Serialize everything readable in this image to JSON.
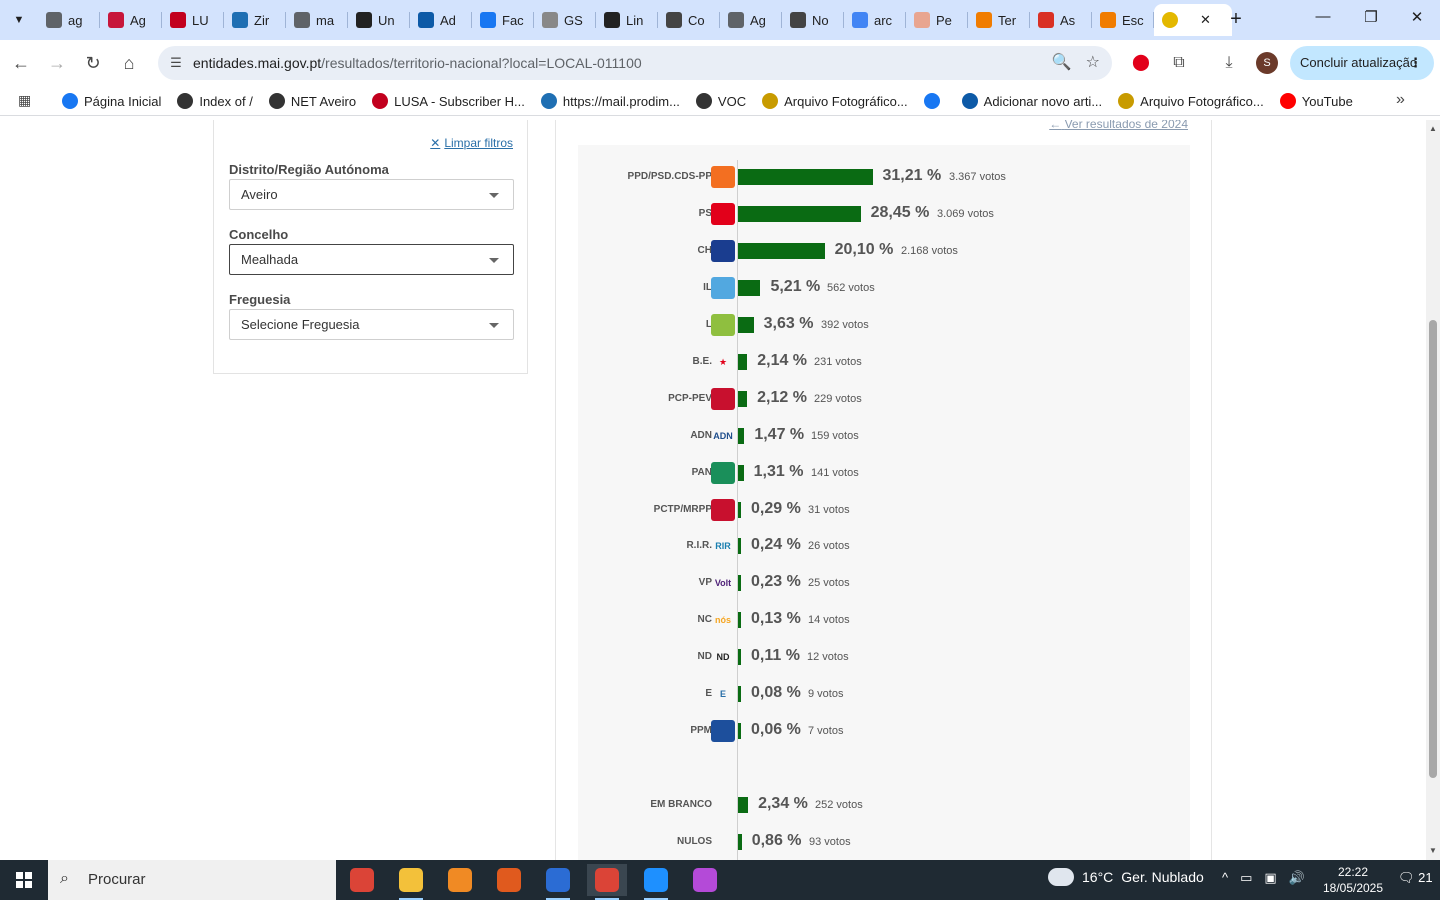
{
  "browser": {
    "tabs": [
      {
        "title": "ag",
        "color": "#5f6368"
      },
      {
        "title": "Ag",
        "color": "#c7163b"
      },
      {
        "title": "LU",
        "color": "#c2001e"
      },
      {
        "title": "Zir",
        "color": "#1f6fb3"
      },
      {
        "title": "ma",
        "color": "#5f6368"
      },
      {
        "title": "Un",
        "color": "#222222"
      },
      {
        "title": "Ad",
        "color": "#0d5aa7"
      },
      {
        "title": "Fac",
        "color": "#1877f2"
      },
      {
        "title": "GS",
        "color": "#888888"
      },
      {
        "title": "Lin",
        "color": "#222222"
      },
      {
        "title": "Co",
        "color": "#444444"
      },
      {
        "title": "Ag",
        "color": "#5f6368"
      },
      {
        "title": "No",
        "color": "#444444"
      },
      {
        "title": "arc",
        "color": "#4285f4"
      },
      {
        "title": "Pe",
        "color": "#e8a590"
      },
      {
        "title": "Ter",
        "color": "#f07c00"
      },
      {
        "title": "As",
        "color": "#d93025"
      },
      {
        "title": "Esc",
        "color": "#f07c00"
      }
    ],
    "active_tab": {
      "title": "",
      "close": "✕",
      "color": "#e3b800"
    },
    "new_tab": "+",
    "window_controls": {
      "minimize": "—",
      "maximize": "❐",
      "close": "✕"
    },
    "nav": {
      "back": "←",
      "forward": "→",
      "reload": "↻",
      "home": "⌂"
    },
    "url_host": "entidades.mai.gov.pt",
    "url_path": "/resultados/territorio-nacional?local=LOCAL-011100",
    "profile_initial": "S",
    "update_label": "Concluir atualização",
    "update_menu": "⋮",
    "bookmarks": [
      {
        "label": "Página Inicial",
        "color": "#1877f2"
      },
      {
        "label": "Index of /",
        "color": "#333333"
      },
      {
        "label": "NET Aveiro",
        "color": "#333333"
      },
      {
        "label": "LUSA - Subscriber H...",
        "color": "#c2001e"
      },
      {
        "label": "https://mail.prodim...",
        "color": "#1f6fb3"
      },
      {
        "label": "VOC",
        "color": "#333333"
      },
      {
        "label": "Arquivo Fotográfico...",
        "color": "#c89b00"
      },
      {
        "label": "",
        "color": "#1877f2"
      },
      {
        "label": "Adicionar novo arti...",
        "color": "#0d5aa7"
      },
      {
        "label": "Arquivo Fotográfico...",
        "color": "#c89b00"
      },
      {
        "label": "YouTube",
        "color": "#ff0000"
      }
    ],
    "bookmarks_more": "»"
  },
  "filters": {
    "clear_label": "Limpar filtros",
    "clear_icon": "✕",
    "district_label": "Distrito/Região Autónoma",
    "district_value": "Aveiro",
    "municipality_label": "Concelho",
    "municipality_value": "Mealhada",
    "parish_label": "Freguesia",
    "parish_value": "Selecione Freguesia"
  },
  "results": {
    "prev_results_label": "Ver resultados de 2024",
    "prev_results_icon": "←"
  },
  "chart_data": {
    "type": "bar",
    "orientation": "horizontal",
    "categories": [
      "PPD/PSD.CDS-PP",
      "PS",
      "CH",
      "IL",
      "L",
      "B.E.",
      "PCP-PEV",
      "ADN",
      "PAN",
      "PCTP/MRPP",
      "R.I.R.",
      "VP",
      "NC",
      "ND",
      "E",
      "PPM",
      "EM BRANCO",
      "NULOS"
    ],
    "values": [
      31.21,
      28.45,
      20.1,
      5.21,
      3.63,
      2.14,
      2.12,
      1.47,
      1.31,
      0.29,
      0.24,
      0.23,
      0.13,
      0.11,
      0.08,
      0.06,
      2.34,
      0.86
    ],
    "pct_labels": [
      "31,21 %",
      "28,45 %",
      "20,10 %",
      "5,21 %",
      "3,63 %",
      "2,14 %",
      "2,12 %",
      "1,47 %",
      "1,31 %",
      "0,29 %",
      "0,24 %",
      "0,23 %",
      "0,13 %",
      "0,11 %",
      "0,08 %",
      "0,06 %",
      "2,34 %",
      "0,86 %"
    ],
    "vote_labels": [
      "3.367 votos",
      "3.069 votos",
      "2.168 votos",
      "562 votos",
      "392 votos",
      "231 votos",
      "229 votos",
      "159 votos",
      "141 votos",
      "31 votos",
      "26 votos",
      "25 votos",
      "14 votos",
      "12 votos",
      "9 votos",
      "7 votos",
      "252 votos",
      "93 votos"
    ],
    "logo_text": [
      "",
      "",
      "",
      "",
      "",
      "★",
      "",
      "ADN",
      "",
      "",
      "RIR",
      "Volt",
      "nós",
      "ND",
      "E",
      ""
    ],
    "logo_colors": [
      "#f36f21",
      "#e2001a",
      "#1a3d8f",
      "#52a8e0",
      "#8fbf3f",
      "#e2001a",
      "#c8102e",
      "#1f4e8c",
      "#1a8f5a",
      "#c8102e",
      "#1a7fb0",
      "#502379",
      "#f5a623",
      "#222222",
      "#2a6fa8",
      "#1d4f9c"
    ],
    "bar_color": "#0a6b13",
    "xlim": [
      0,
      100
    ]
  },
  "taskbar": {
    "search_placeholder": "Procurar",
    "search_icon": "⌕",
    "apps": [
      {
        "name": "chrome",
        "color": "#db4437",
        "running": false,
        "active": false
      },
      {
        "name": "file-explorer",
        "color": "#f3c13a",
        "running": true,
        "active": false
      },
      {
        "name": "app-gear",
        "color": "#f08a24",
        "running": false,
        "active": false
      },
      {
        "name": "app-c",
        "color": "#e05a1e",
        "running": false,
        "active": false
      },
      {
        "name": "document",
        "color": "#2b6cd4",
        "running": true,
        "active": false
      },
      {
        "name": "chrome-active",
        "color": "#db4437",
        "running": true,
        "active": true
      },
      {
        "name": "photos",
        "color": "#1e90ff",
        "running": true,
        "active": false
      },
      {
        "name": "drop-app",
        "color": "#b44ad8",
        "running": false,
        "active": false
      }
    ],
    "weather_temp": "16°C",
    "weather_text": "Ger. Nublado",
    "tray_icons": [
      "^",
      "▭",
      "▣",
      "🔊"
    ],
    "time": "22:22",
    "date": "18/05/2025",
    "notifications": "21"
  }
}
